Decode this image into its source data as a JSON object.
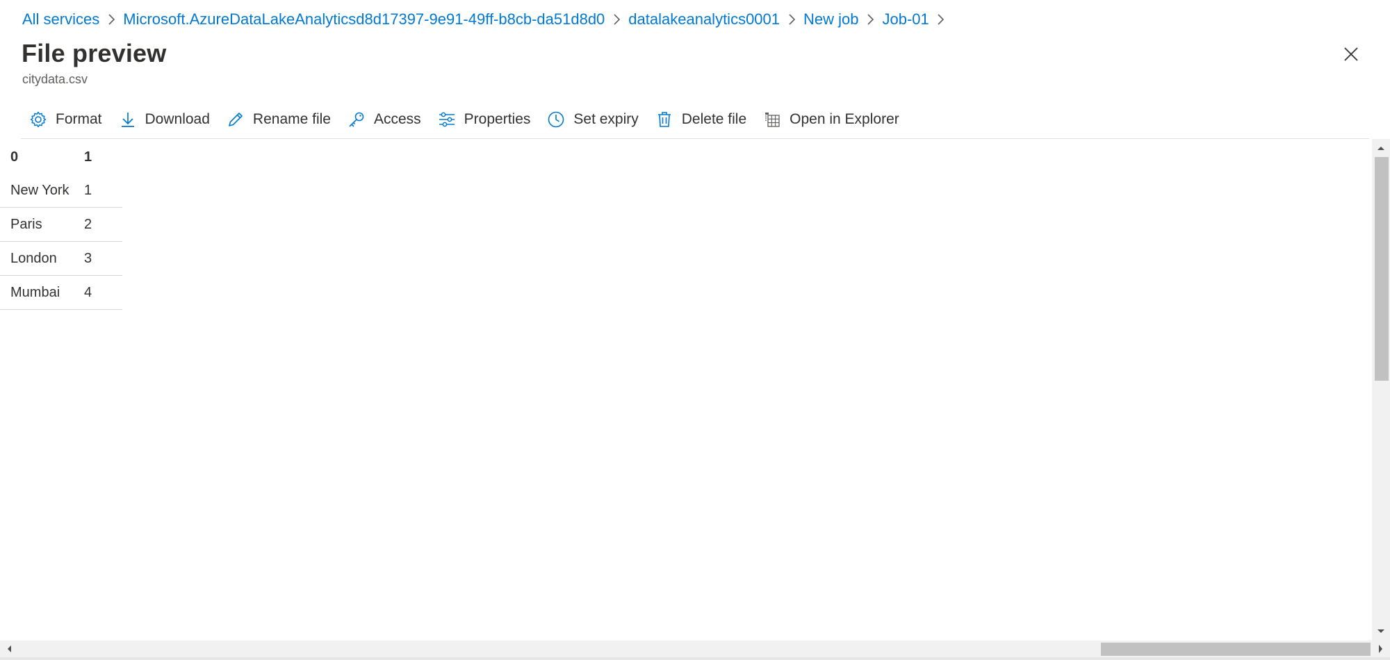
{
  "breadcrumb": {
    "items": [
      {
        "label": "All services"
      },
      {
        "label": "Microsoft.AzureDataLakeAnalyticsd8d17397-9e91-49ff-b8cb-da51d8d0"
      },
      {
        "label": "datalakeanalytics0001"
      },
      {
        "label": "New job"
      },
      {
        "label": "Job-01"
      }
    ]
  },
  "page": {
    "title": "File preview",
    "subtitle": "citydata.csv"
  },
  "toolbar": {
    "items": [
      {
        "label": "Format",
        "icon": "gear-icon"
      },
      {
        "label": "Download",
        "icon": "download-icon"
      },
      {
        "label": "Rename file",
        "icon": "pencil-icon"
      },
      {
        "label": "Access",
        "icon": "key-icon"
      },
      {
        "label": "Properties",
        "icon": "sliders-icon"
      },
      {
        "label": "Set expiry",
        "icon": "clock-icon"
      },
      {
        "label": "Delete file",
        "icon": "trash-icon"
      },
      {
        "label": "Open in Explorer",
        "icon": "explorer-icon"
      }
    ]
  },
  "table": {
    "headers": [
      "0",
      "1"
    ],
    "rows": [
      [
        "New York",
        "1"
      ],
      [
        "Paris",
        "2"
      ],
      [
        "London",
        "3"
      ],
      [
        "Mumbai",
        "4"
      ]
    ]
  },
  "colors": {
    "accent": "#0078d4",
    "text": "#323130",
    "muted": "#605e5c"
  }
}
